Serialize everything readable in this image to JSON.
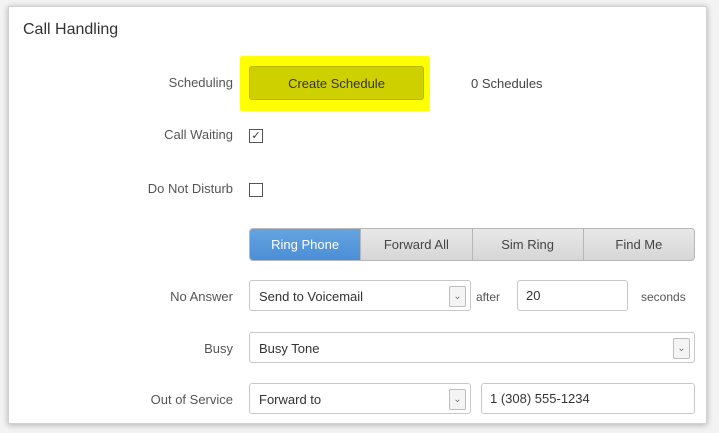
{
  "section": {
    "title": "Call Handling"
  },
  "scheduling": {
    "label": "Scheduling",
    "button": "Create Schedule",
    "count": "0 Schedules"
  },
  "call_waiting": {
    "label": "Call Waiting",
    "checked": true,
    "mark": "✓"
  },
  "do_not_disturb": {
    "label": "Do Not Disturb",
    "checked": false
  },
  "modes": {
    "items": [
      "Ring Phone",
      "Forward All",
      "Sim Ring",
      "Find Me"
    ],
    "selected": "Ring Phone"
  },
  "no_answer": {
    "label": "No Answer",
    "action": "Send to Voicemail",
    "after_label": "after",
    "seconds_value": "20",
    "seconds_label": "seconds"
  },
  "busy": {
    "label": "Busy",
    "action": "Busy Tone"
  },
  "out_of_service": {
    "label": "Out of Service",
    "action": "Forward to",
    "number": "1 (308) 555-1234"
  },
  "icons": {
    "caret": "⌄"
  },
  "colors": {
    "highlight": "#ffff00",
    "active_tab": "#4a8ed6"
  }
}
